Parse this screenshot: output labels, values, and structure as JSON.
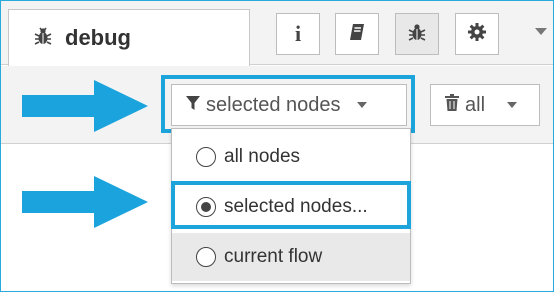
{
  "tab": {
    "label": "debug",
    "icon": "bug-icon"
  },
  "sidebar_buttons": [
    {
      "icon": "info-icon",
      "glyph": "i"
    },
    {
      "icon": "book-icon"
    },
    {
      "icon": "bug-icon",
      "selected": true
    },
    {
      "icon": "gear-icon"
    }
  ],
  "toolbar": {
    "filter_label": "selected nodes",
    "filter_icon": "filter-icon",
    "clear_label": "all",
    "clear_icon": "trash-icon"
  },
  "filter_menu": {
    "items": [
      {
        "label": "all nodes",
        "checked": false
      },
      {
        "label": "selected nodes...",
        "checked": true
      },
      {
        "label": "current flow",
        "checked": false
      }
    ]
  },
  "colors": {
    "highlight": "#1da4db",
    "arrow": "#1aa3dd"
  }
}
